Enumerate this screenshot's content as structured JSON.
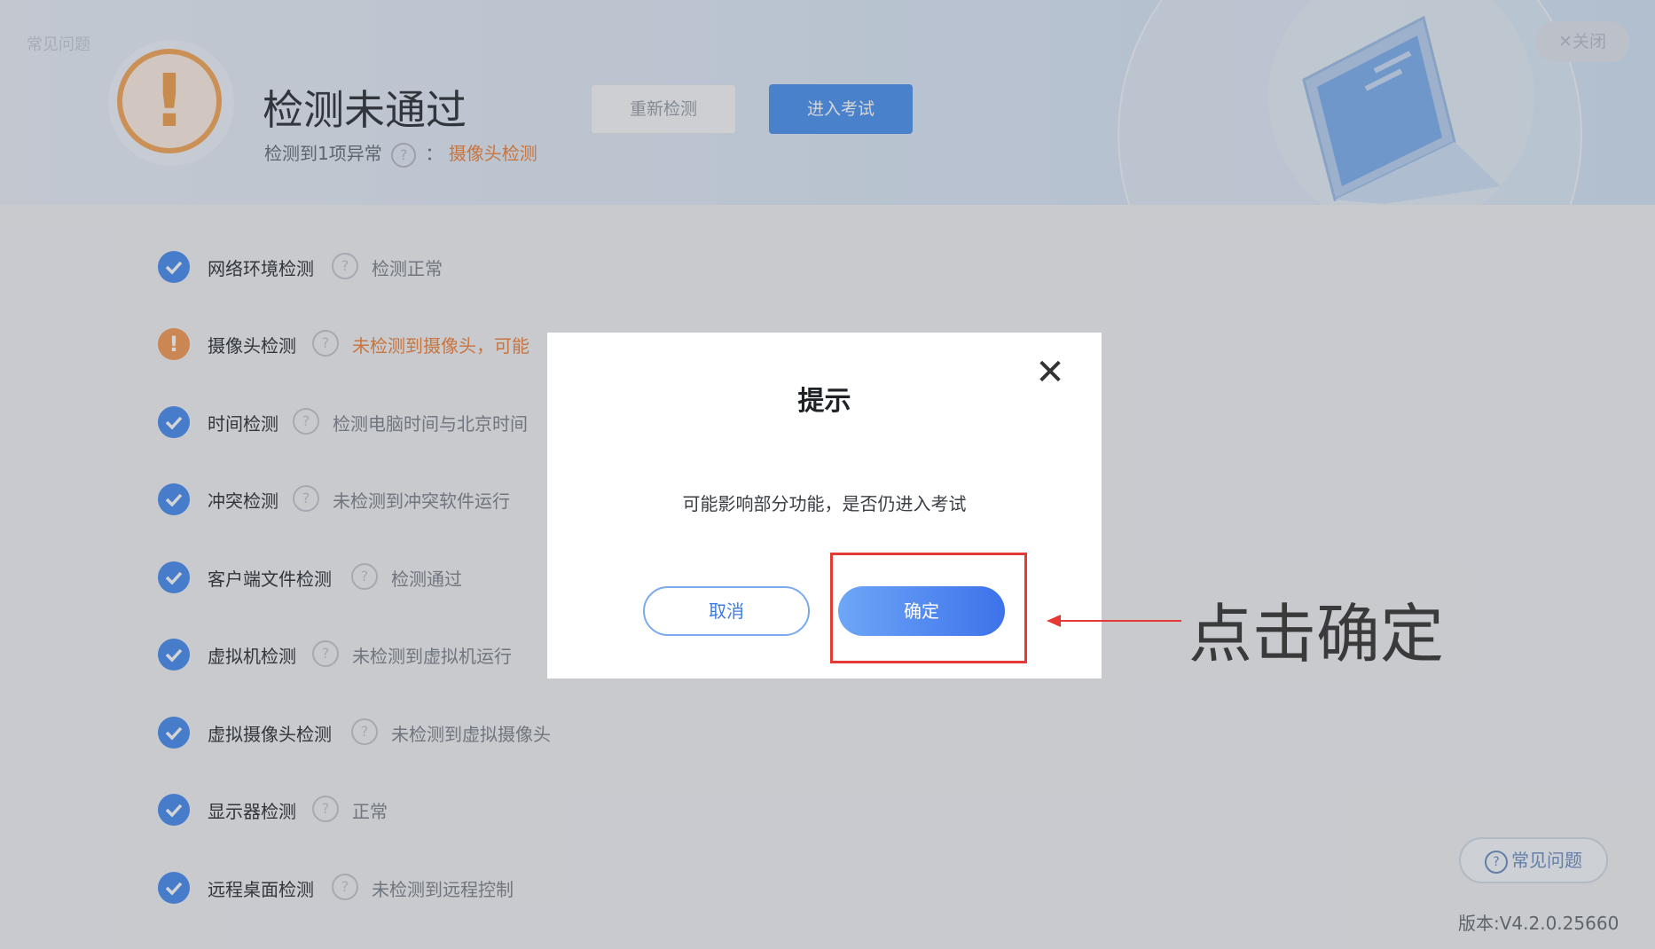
{
  "header": {
    "small_text": "常见问题",
    "title": "检测未通过",
    "subtitle_prefix": "检测到1项异常",
    "subtitle_help": "?",
    "subtitle_sep": "：",
    "subtitle_item": "摄像头检测",
    "recheck_label": "重新检测",
    "enter_exam_label": "进入考试",
    "close_label": "✕关闭",
    "warn_glyph": "!"
  },
  "checks": [
    {
      "name": "网络环境检测",
      "status": "检测正常",
      "state": "ok"
    },
    {
      "name": "摄像头检测",
      "status": "未检测到摄像头，可能",
      "state": "warn"
    },
    {
      "name": "时间检测",
      "status": "检测电脑时间与北京时间",
      "state": "ok"
    },
    {
      "name": "冲突检测",
      "status": "未检测到冲突软件运行",
      "state": "ok"
    },
    {
      "name": "客户端文件检测",
      "status": "检测通过",
      "state": "ok"
    },
    {
      "name": "虚拟机检测",
      "status": "未检测到虚拟机运行",
      "state": "ok"
    },
    {
      "name": "虚拟摄像头检测",
      "status": "未检测到虚拟摄像头",
      "state": "ok"
    },
    {
      "name": "显示器检测",
      "status": "正常",
      "state": "ok"
    },
    {
      "name": "远程桌面检测",
      "status": "未检测到远程控制",
      "state": "ok"
    }
  ],
  "help_glyph": "?",
  "warn_glyph": "!",
  "faq_label": "常见问题",
  "version": "版本:V4.2.0.25660",
  "dialog": {
    "title": "提示",
    "message": "可能影响部分功能，是否仍进入考试",
    "cancel_label": "取消",
    "confirm_label": "确定",
    "close_glyph": "✕"
  },
  "annotation": {
    "callout": "点击确定",
    "box_color": "#e53935"
  },
  "colors": {
    "accent": "#4d95ef",
    "warning": "#f0843e",
    "ok": "#4a8eee"
  }
}
